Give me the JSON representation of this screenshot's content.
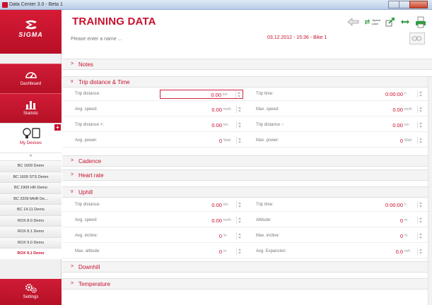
{
  "window": {
    "title": "Data Center 3.0 - Beta 1"
  },
  "brand": {
    "name": "SIGMA"
  },
  "sidebar": {
    "nav": [
      {
        "label": "Dashboard",
        "icon": "gauge-icon"
      },
      {
        "label": "Statistic",
        "icon": "bar-chart-icon"
      }
    ],
    "devices_label": "My Devices",
    "caret": "^",
    "device_list": [
      "BC 1609 Demo",
      "BC 1609 STS Demo",
      "BC 1909 HR Demo",
      "BC 2209 MHR De...",
      "BC 14.11 Demo",
      "ROX 8.0 Demo",
      "ROX 8.1 Demo",
      "ROX 9.0 Demo",
      "ROX 9.1 Demo"
    ],
    "active_device": 8,
    "settings_label": "Settings"
  },
  "page": {
    "title": "TRAINING DATA",
    "name_placeholder": "Please enter a name ...",
    "info": "03.12.2012 - 15:36 - Bike 1",
    "speed_pace": {
      "top": "Speed",
      "bottom": "pace"
    }
  },
  "sections": {
    "notes": {
      "arrow": ">",
      "title": "Notes"
    },
    "trip": {
      "arrow": "v",
      "title": "Trip distance & Time",
      "rows": [
        {
          "l": "Trip distance:",
          "lv": "0.00",
          "lu": "km",
          "r": "Trip time:",
          "rv": "0:00:00",
          "ru": "h"
        },
        {
          "l": "Avg. speed:",
          "lv": "0.00",
          "lu": "km/h",
          "r": "Max. speed:",
          "rv": "0.00",
          "ru": "km/h"
        },
        {
          "l": "Trip distance +:",
          "lv": "0.00",
          "lu": "km",
          "r": "Trip distance -:",
          "rv": "0.00",
          "ru": "km"
        },
        {
          "l": "Avg. power:",
          "lv": "0",
          "lu": "Watt",
          "r": "Max. power:",
          "rv": "0",
          "ru": "Watt"
        }
      ]
    },
    "cadence": {
      "arrow": ">",
      "title": "Cadence"
    },
    "heart": {
      "arrow": ">",
      "title": "Heart rate"
    },
    "uphill": {
      "arrow": "v",
      "title": "Uphill",
      "rows": [
        {
          "l": "Trip distance:",
          "lv": "0.00",
          "lu": "km",
          "r": "Trip time:",
          "rv": "0:00:00",
          "ru": "h"
        },
        {
          "l": "Avg. speed:",
          "lv": "0.00",
          "lu": "km/h",
          "r": "Altitude:",
          "rv": "0",
          "ru": "m"
        },
        {
          "l": "Avg. incline:",
          "lv": "0",
          "lu": "%",
          "r": "Max. incline:",
          "rv": "0",
          "ru": "%"
        },
        {
          "l": "Max. altitude:",
          "lv": "0",
          "lu": "m",
          "r": "Avg. Expansion:",
          "rv": "0.0",
          "ru": "m/h"
        }
      ]
    },
    "downhill": {
      "arrow": ">",
      "title": "Downhill"
    },
    "temperature": {
      "arrow": ">",
      "title": "Temperature"
    }
  }
}
